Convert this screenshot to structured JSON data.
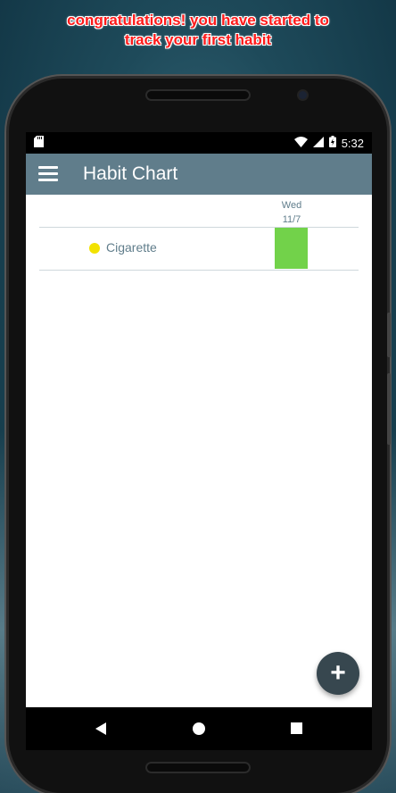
{
  "caption": {
    "line1": "congratulations! you have started to",
    "line2": "track your first habit"
  },
  "status_bar": {
    "time": "5:32",
    "icons": [
      "sd-card-icon",
      "wifi-icon",
      "cell-signal-icon",
      "battery-charging-icon"
    ]
  },
  "app_bar": {
    "title": "Habit Chart",
    "menu_icon": "hamburger-menu-icon"
  },
  "chart": {
    "date_columns": [
      {
        "day": "Wed",
        "date": "11/7"
      }
    ],
    "habits": [
      {
        "name": "Cigarette",
        "dot_color": "#f2e200",
        "cells": [
          {
            "done": true,
            "color": "#72d24a"
          }
        ]
      }
    ]
  },
  "fab": {
    "label": "+",
    "icon": "add-icon"
  },
  "nav_bar": {
    "icons": [
      "back-icon",
      "home-icon",
      "recents-icon"
    ]
  },
  "colors": {
    "app_bar": "#607d8b",
    "fab": "#37474f",
    "done_cell": "#72d24a",
    "caption": "#ff1a1a"
  }
}
